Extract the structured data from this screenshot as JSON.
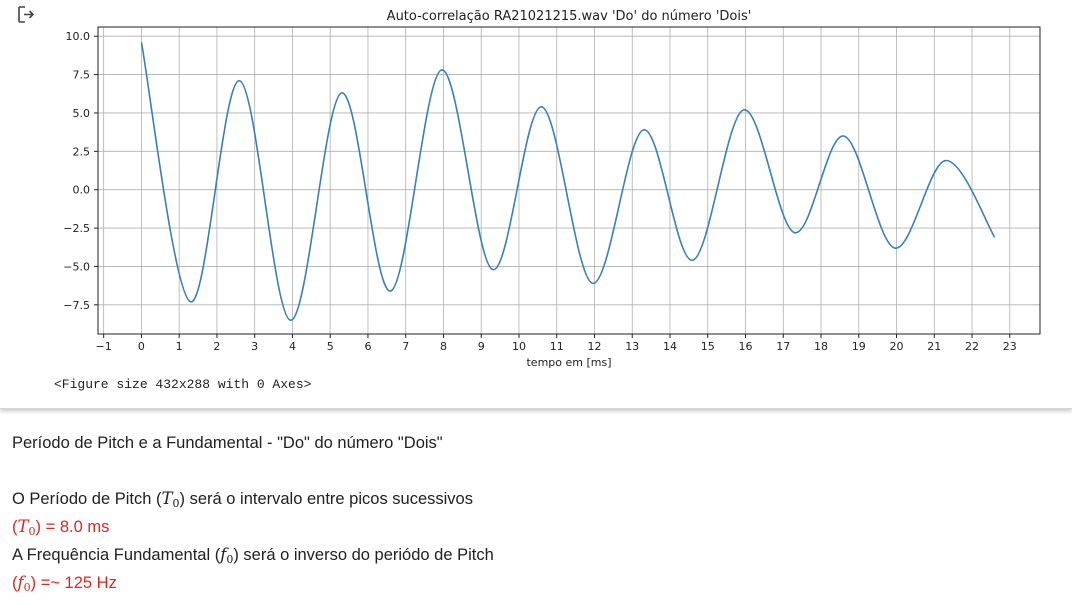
{
  "output": {
    "icon": "output-arrow-icon",
    "console_text": "<Figure size 432x288 with 0 Axes>"
  },
  "chart_data": {
    "type": "line",
    "title": "Auto-correlação RA21021215.wav 'Do' do número 'Dois'",
    "xlabel": "tempo em [ms]",
    "ylabel": "",
    "xlim": [
      -1.15,
      23.8
    ],
    "ylim": [
      -9.4,
      10.6
    ],
    "xticks": [
      -1,
      0,
      1,
      2,
      3,
      4,
      5,
      6,
      7,
      8,
      9,
      10,
      11,
      12,
      13,
      14,
      15,
      16,
      17,
      18,
      19,
      20,
      21,
      22,
      23
    ],
    "xtick_labels": [
      "−1",
      "0",
      "1",
      "2",
      "3",
      "4",
      "5",
      "6",
      "7",
      "8",
      "9",
      "10",
      "11",
      "12",
      "13",
      "14",
      "15",
      "16",
      "17",
      "18",
      "19",
      "20",
      "21",
      "22",
      "23"
    ],
    "yticks": [
      -7.5,
      -5.0,
      -2.5,
      0.0,
      2.5,
      5.0,
      7.5,
      10.0
    ],
    "ytick_labels": [
      "−7.5",
      "−5.0",
      "−2.5",
      "0.0",
      "2.5",
      "5.0",
      "7.5",
      "10.0"
    ],
    "grid": true,
    "line_color": "#3a7fb8",
    "series": [
      {
        "x": [
          0.0,
          1.3,
          2.6,
          3.95,
          5.3,
          6.6,
          7.95,
          9.3,
          10.6,
          11.95,
          13.3,
          14.6,
          15.95,
          17.3,
          18.6,
          19.95,
          21.3,
          22.6
        ],
        "values": [
          9.6,
          -7.3,
          7.1,
          -8.5,
          6.3,
          -6.6,
          7.8,
          -5.2,
          5.4,
          -6.1,
          3.9,
          -4.6,
          5.2,
          -2.8,
          3.5,
          -3.8,
          1.9,
          -3.1
        ]
      }
    ]
  },
  "text": {
    "heading": "Período de Pitch e a Fundamental - \"Do\" do número \"Dois\"",
    "line1_pre": "O Período de Pitch (",
    "line1_sym": "T",
    "line1_sub": "0",
    "line1_post": ") será o intervalo entre picos sucessivos",
    "line2_pre": "(",
    "line2_sym": "T",
    "line2_sub": "0",
    "line2_post": ") = 8.0 ms",
    "line3_pre": "A Frequência Fundamental (",
    "line3_sym": "f",
    "line3_sub": "0",
    "line3_post": ") será o inverso do periódo de Pitch",
    "line4_pre": "(",
    "line4_sym": "f",
    "line4_sub": "0",
    "line4_post": ") =~ 125 Hz"
  }
}
